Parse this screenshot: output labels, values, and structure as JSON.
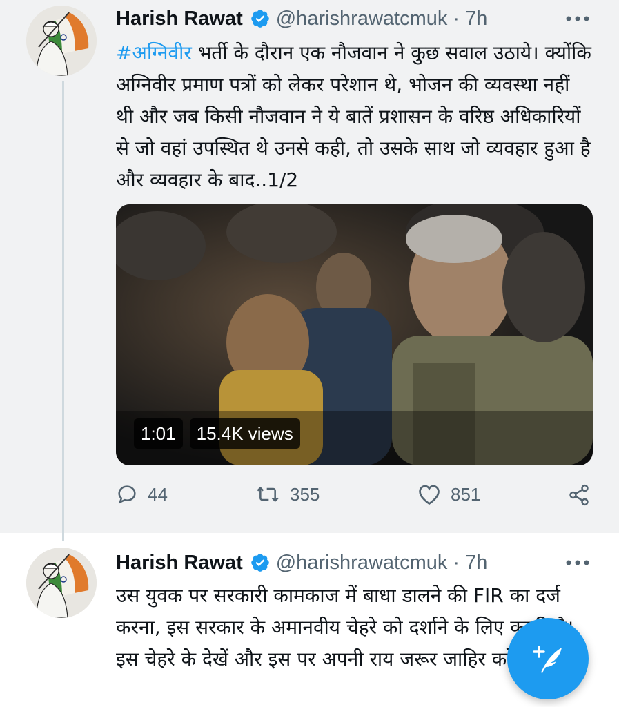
{
  "tweets": [
    {
      "author_name": "Harish Rawat",
      "handle_time": "@harishrawatcmuk · 7h",
      "hashtag": "#अग्निवीर",
      "text_after_hashtag": " भर्ती के दौरान एक नौजवान ने कुछ सवाल उठाये। क्योंकि अग्निवीर प्रमाण पत्रों को लेकर परेशान थे, भोजन की व्यवस्था नहीं थी और जब किसी नौजवान ने ये बातें प्रशासन के वरिष्ठ अधिकारियों से जो वहां उपस्थित थे उनसे कही, तो उसके साथ जो व्यवहार हुआ है और व्यवहार के बाद..1/2",
      "video_duration": "1:01",
      "video_views": "15.4K views",
      "reply_count": "44",
      "retweet_count": "355",
      "like_count": "851"
    },
    {
      "author_name": "Harish Rawat",
      "handle_time": "@harishrawatcmuk · 7h",
      "text": "उस युवक पर सरकारी कामकाज में बाधा डालने की FIR का दर्ज करना, इस सरकार के अमानवीय चेहरे को दर्शाने के लिए काफी है। इस चेहरे के देखें और इस पर अपनी राय जरूर जाहिर करें।"
    }
  ],
  "icons": {
    "verified": "verified-badge-icon",
    "more": "more-dots-icon",
    "reply": "reply-icon",
    "retweet": "retweet-icon",
    "like": "heart-icon",
    "share": "share-icon",
    "compose": "compose-tweet-icon"
  },
  "colors": {
    "accent": "#1d9bf0",
    "muted": "#536471",
    "text": "#0f1419",
    "highlight_background": "#f1f2f3"
  }
}
